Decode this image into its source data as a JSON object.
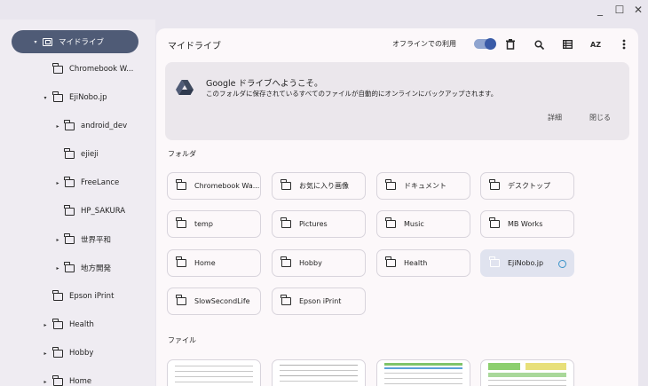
{
  "window": {
    "minimize": "_",
    "maximize": "☐",
    "close": "✕"
  },
  "sidebar": {
    "items": [
      {
        "label": "マイドライブ",
        "arrow": "▾",
        "selected": true
      },
      {
        "label": "Chromebook W...",
        "arrow": ""
      },
      {
        "label": "EjiNobo.jp",
        "arrow": "▾"
      },
      {
        "label": "android_dev",
        "arrow": "▸"
      },
      {
        "label": "ejieji",
        "arrow": ""
      },
      {
        "label": "FreeLance",
        "arrow": "▸"
      },
      {
        "label": "HP_SAKURA",
        "arrow": ""
      },
      {
        "label": "世界平和",
        "arrow": "▸"
      },
      {
        "label": "地方開発",
        "arrow": "▸"
      },
      {
        "label": "Epson iPrint",
        "arrow": ""
      },
      {
        "label": "Health",
        "arrow": "▸"
      },
      {
        "label": "Hobby",
        "arrow": "▸"
      },
      {
        "label": "Home",
        "arrow": "▸"
      }
    ]
  },
  "main": {
    "title": "マイドライブ",
    "offline_label": "オフラインでの利用",
    "offline_enabled": true,
    "toolbar": {
      "delete_icon": "trash-icon",
      "search_icon": "search-icon",
      "view_icon": "list-view-icon",
      "sort_icon": "sort-az-icon",
      "sort_label": "AZ",
      "more_icon": "more-vert-icon"
    },
    "banner": {
      "title": "Google ドライブへようこそ。",
      "text": "このフォルダに保存されているすべてのファイルが自動的にオンラインにバックアップされます。",
      "details": "詳細",
      "close": "閉じる"
    },
    "folders_label": "フォルダ",
    "folders": [
      {
        "name": "Chromebook Wa..."
      },
      {
        "name": "お気に入り画像"
      },
      {
        "name": "ドキュメント"
      },
      {
        "name": "デスクトップ"
      },
      {
        "name": "temp"
      },
      {
        "name": "Pictures"
      },
      {
        "name": "Music"
      },
      {
        "name": "MB Works"
      },
      {
        "name": "Home"
      },
      {
        "name": "Hobby"
      },
      {
        "name": "Health"
      },
      {
        "name": "EjiNobo.jp",
        "selected": true
      },
      {
        "name": "SlowSecondLife"
      },
      {
        "name": "Epson iPrint"
      }
    ],
    "files_label": "ファイル"
  },
  "colors": {
    "selected_nav": "#4f5b76",
    "accent": "#3a5ba7",
    "sync": "#3b93c9"
  }
}
